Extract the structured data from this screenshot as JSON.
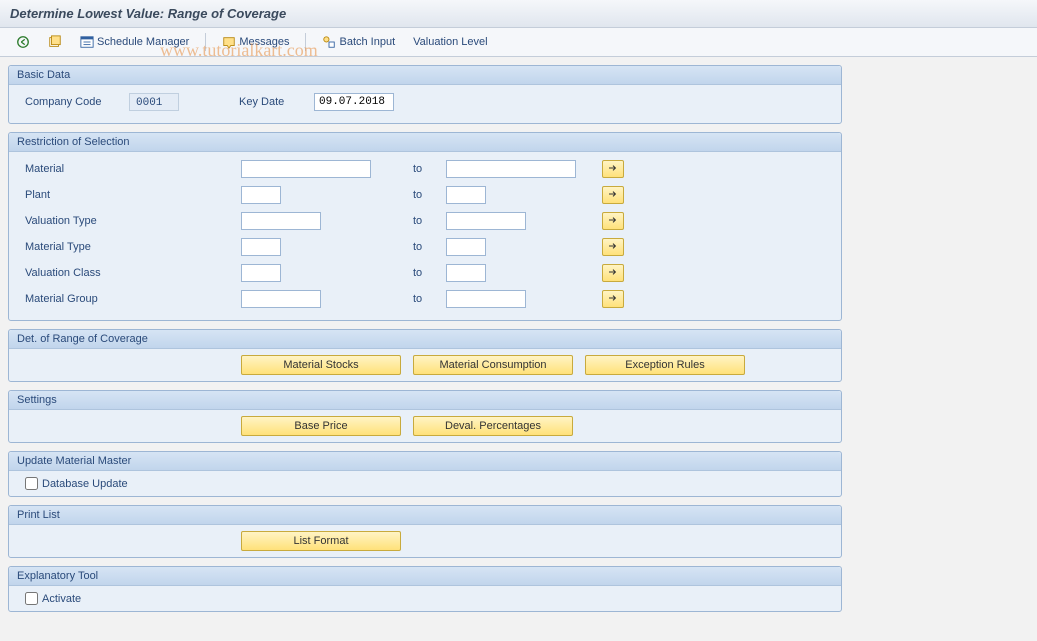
{
  "title": "Determine Lowest Value: Range of Coverage",
  "watermark": "www.tutorialkart.com",
  "toolbar": {
    "schedule_manager": "Schedule Manager",
    "messages": "Messages",
    "batch_input": "Batch Input",
    "valuation_level": "Valuation Level"
  },
  "basic_data": {
    "header": "Basic Data",
    "company_code_label": "Company Code",
    "company_code_value": "0001",
    "key_date_label": "Key Date",
    "key_date_value": "09.07.2018"
  },
  "restriction": {
    "header": "Restriction of Selection",
    "to_label": "to",
    "rows": [
      {
        "label": "Material",
        "from_w": "w-lg",
        "to_w": "w-lg"
      },
      {
        "label": "Plant",
        "from_w": "w-sm",
        "to_w": "w-sm"
      },
      {
        "label": "Valuation Type",
        "from_w": "w-md",
        "to_w": "w-md"
      },
      {
        "label": "Material Type",
        "from_w": "w-sm",
        "to_w": "w-sm"
      },
      {
        "label": "Valuation Class",
        "from_w": "w-sm",
        "to_w": "w-sm"
      },
      {
        "label": "Material Group",
        "from_w": "w-md",
        "to_w": "w-md"
      }
    ]
  },
  "range_coverage": {
    "header": "Det. of Range of Coverage",
    "buttons": [
      "Material Stocks",
      "Material Consumption",
      "Exception Rules"
    ]
  },
  "settings": {
    "header": "Settings",
    "buttons": [
      "Base Price",
      "Deval. Percentages"
    ]
  },
  "update_master": {
    "header": "Update Material Master",
    "checkbox_label": "Database Update"
  },
  "print_list": {
    "header": "Print List",
    "button": "List Format"
  },
  "explanatory": {
    "header": "Explanatory Tool",
    "checkbox_label": "Activate"
  }
}
